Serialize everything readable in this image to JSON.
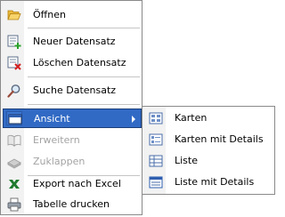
{
  "context_menu": {
    "items": [
      {
        "label": "Öffnen",
        "icon": "folder-open-icon"
      },
      {
        "label": "Neuer Datensatz",
        "icon": "new-record-icon"
      },
      {
        "label": "Löschen Datensatz",
        "icon": "delete-record-icon"
      },
      {
        "label": "Suche Datensatz",
        "icon": "search-icon"
      },
      {
        "label": "Ansicht",
        "icon": "view-icon",
        "state": "highlighted"
      },
      {
        "label": "Erweitern",
        "icon": "expand-book-icon",
        "state": "disabled"
      },
      {
        "label": "Zuklappen",
        "icon": "collapse-icon",
        "state": "disabled"
      },
      {
        "label": "Export nach Excel",
        "icon": "excel-export-icon"
      },
      {
        "label": "Tabelle drucken",
        "icon": "printer-icon"
      }
    ]
  },
  "view_submenu": {
    "items": [
      {
        "label": "Karten",
        "icon": "cards-view-icon"
      },
      {
        "label": "Karten mit Details",
        "icon": "cards-details-view-icon"
      },
      {
        "label": "Liste",
        "icon": "list-view-icon"
      },
      {
        "label": "Liste mit Details",
        "icon": "list-details-view-icon"
      }
    ]
  },
  "colors": {
    "highlight": "#316ac5",
    "disabled_text": "#a3a3a3",
    "gutter": "#f2f2f2"
  }
}
